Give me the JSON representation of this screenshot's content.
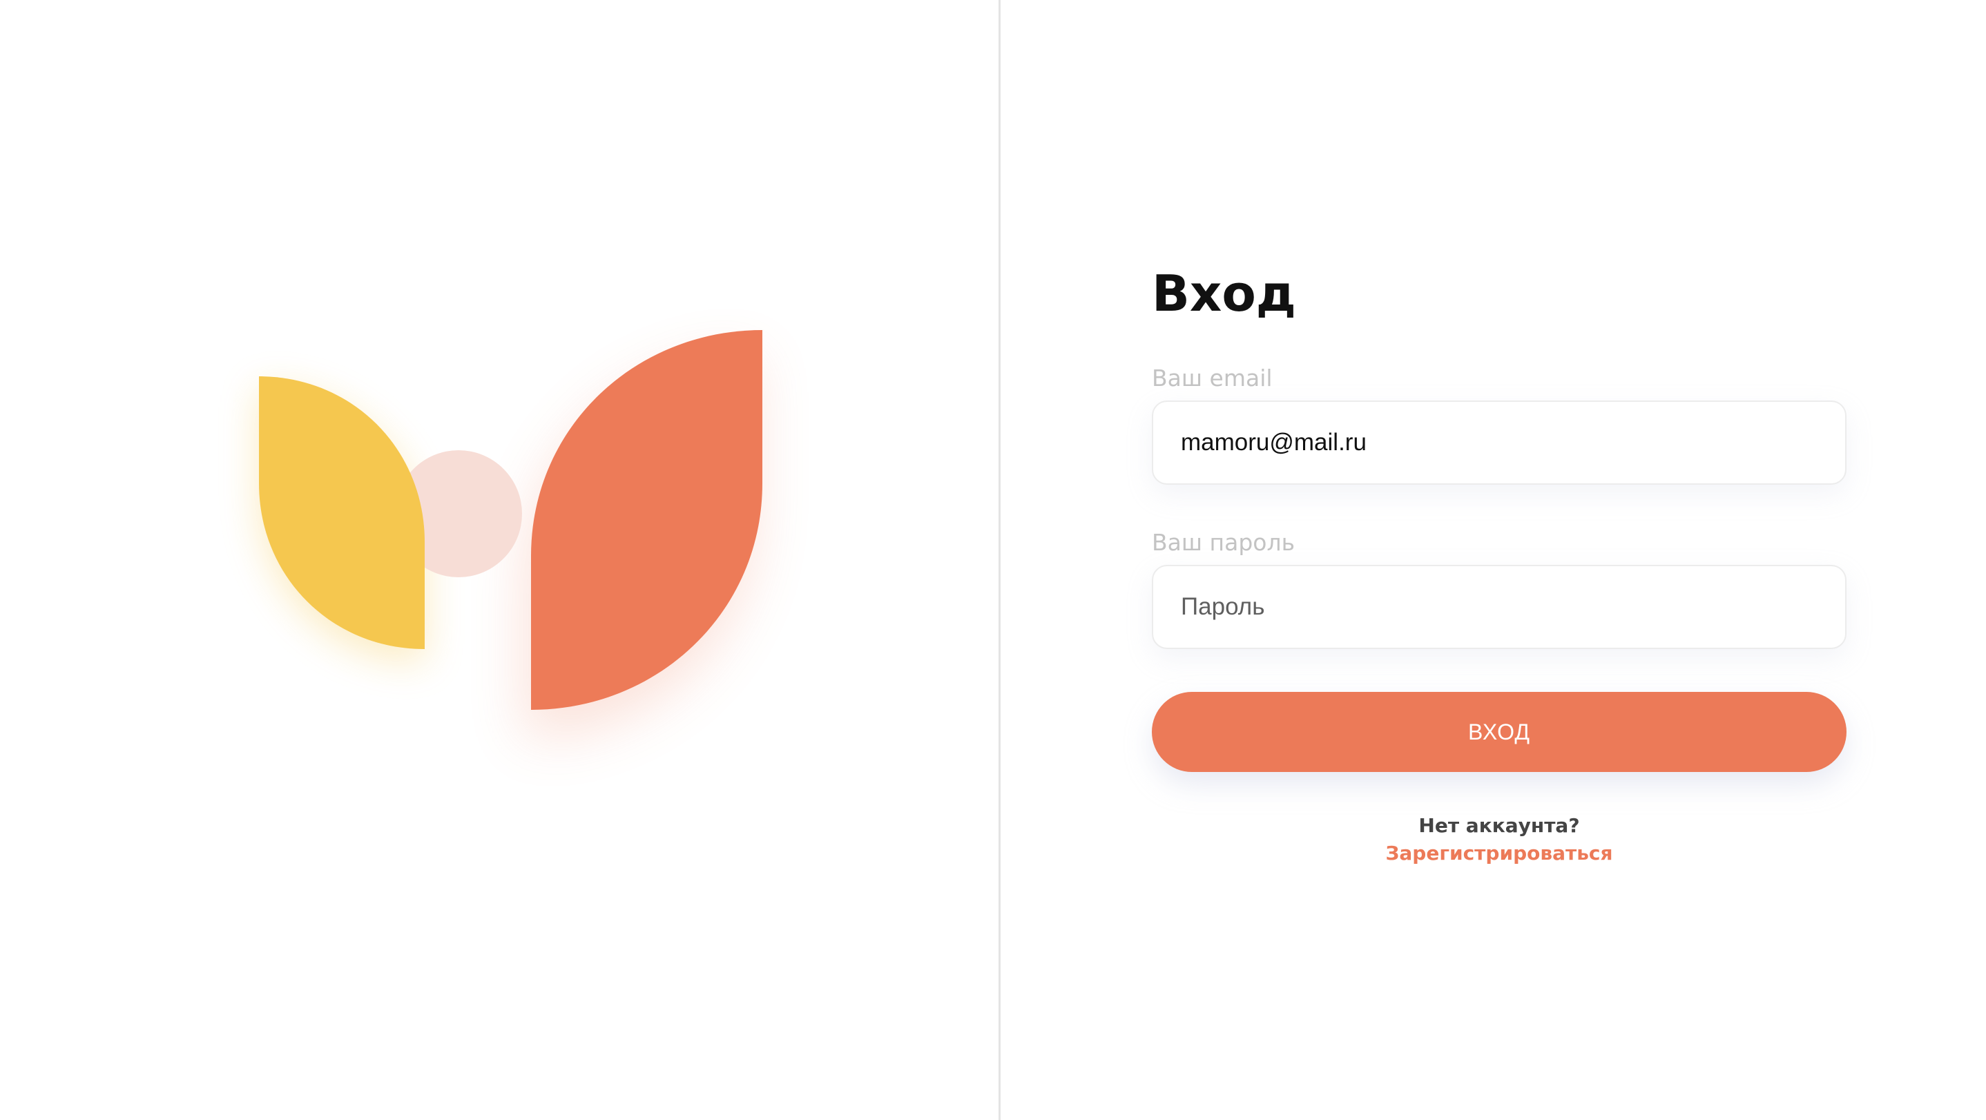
{
  "login": {
    "title": "Вход",
    "email_label": "Ваш email",
    "email_value": "mamoru@mail.ru",
    "password_label": "Ваш пароль",
    "password_placeholder": "Пароль",
    "submit_label": "ВХОД",
    "no_account_text": "Нет аккаунта?",
    "register_link": "Зарегистрироваться"
  },
  "colors": {
    "accent": "#ec7a58",
    "logo_yellow": "#f5c74f",
    "logo_orange": "#ed7b58",
    "logo_circle": "#f7ddd6",
    "label_gray": "#c3c3c3",
    "divider": "#e4e4e4"
  }
}
